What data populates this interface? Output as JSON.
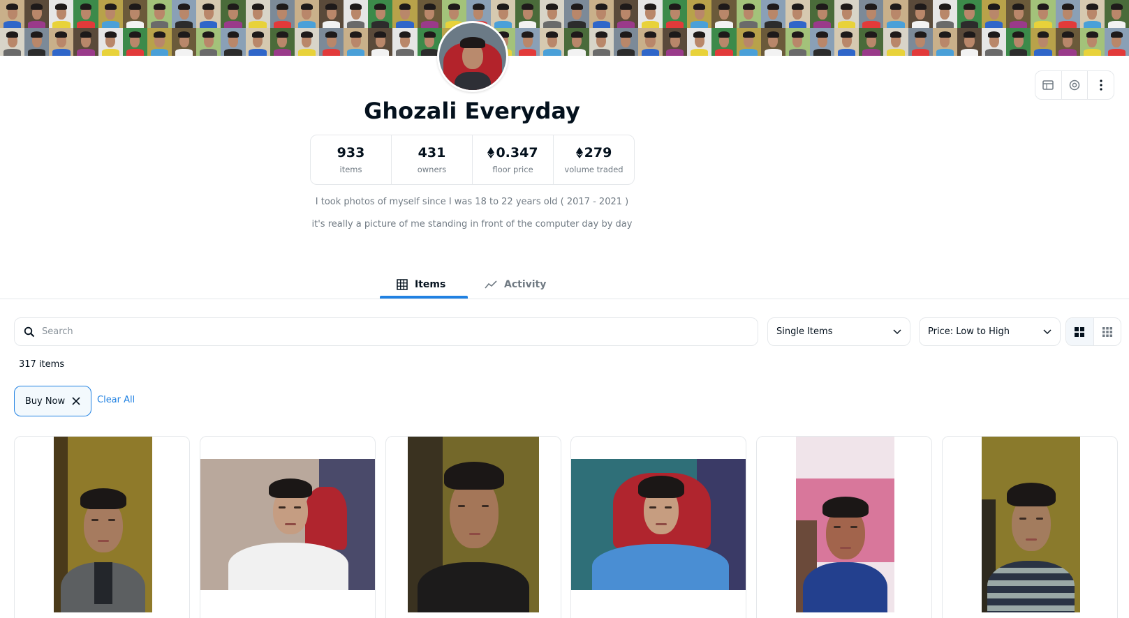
{
  "collection": {
    "name": "Ghozali Everyday",
    "description_lines": [
      "I took photos of myself since I was 18 to 22 years old ( 2017 - 2021 )",
      "it's really a picture of me standing in front of the computer day by day"
    ]
  },
  "stats": [
    {
      "value": "933",
      "label": "items",
      "eth": false
    },
    {
      "value": "431",
      "label": "owners",
      "eth": false
    },
    {
      "value": "0.347",
      "label": "floor price",
      "eth": true
    },
    {
      "value": "279",
      "label": "volume traded",
      "eth": true
    }
  ],
  "tabs": {
    "items_label": "Items",
    "activity_label": "Activity"
  },
  "filters": {
    "search_placeholder": "Search",
    "type_select": "Single Items",
    "sort_select": "Price: Low to High"
  },
  "results": {
    "count_label": "317 items",
    "active_filter": "Buy Now",
    "clear_label": "Clear All"
  },
  "colors": {
    "accent": "#2081e2",
    "text": "#04111d",
    "muted": "#707a83",
    "border": "#e5e8eb"
  },
  "icons": {
    "header_actions": [
      "website-icon",
      "instagram-icon",
      "more-vertical-icon"
    ],
    "items_tab": "grid-icon",
    "activity_tab": "trend-line-icon",
    "search": "search-icon",
    "chevron": "chevron-down-icon",
    "view_large": "large-grid-icon",
    "view_small": "small-grid-icon",
    "remove_filter": "close-icon",
    "currency": "ethereum-icon"
  }
}
